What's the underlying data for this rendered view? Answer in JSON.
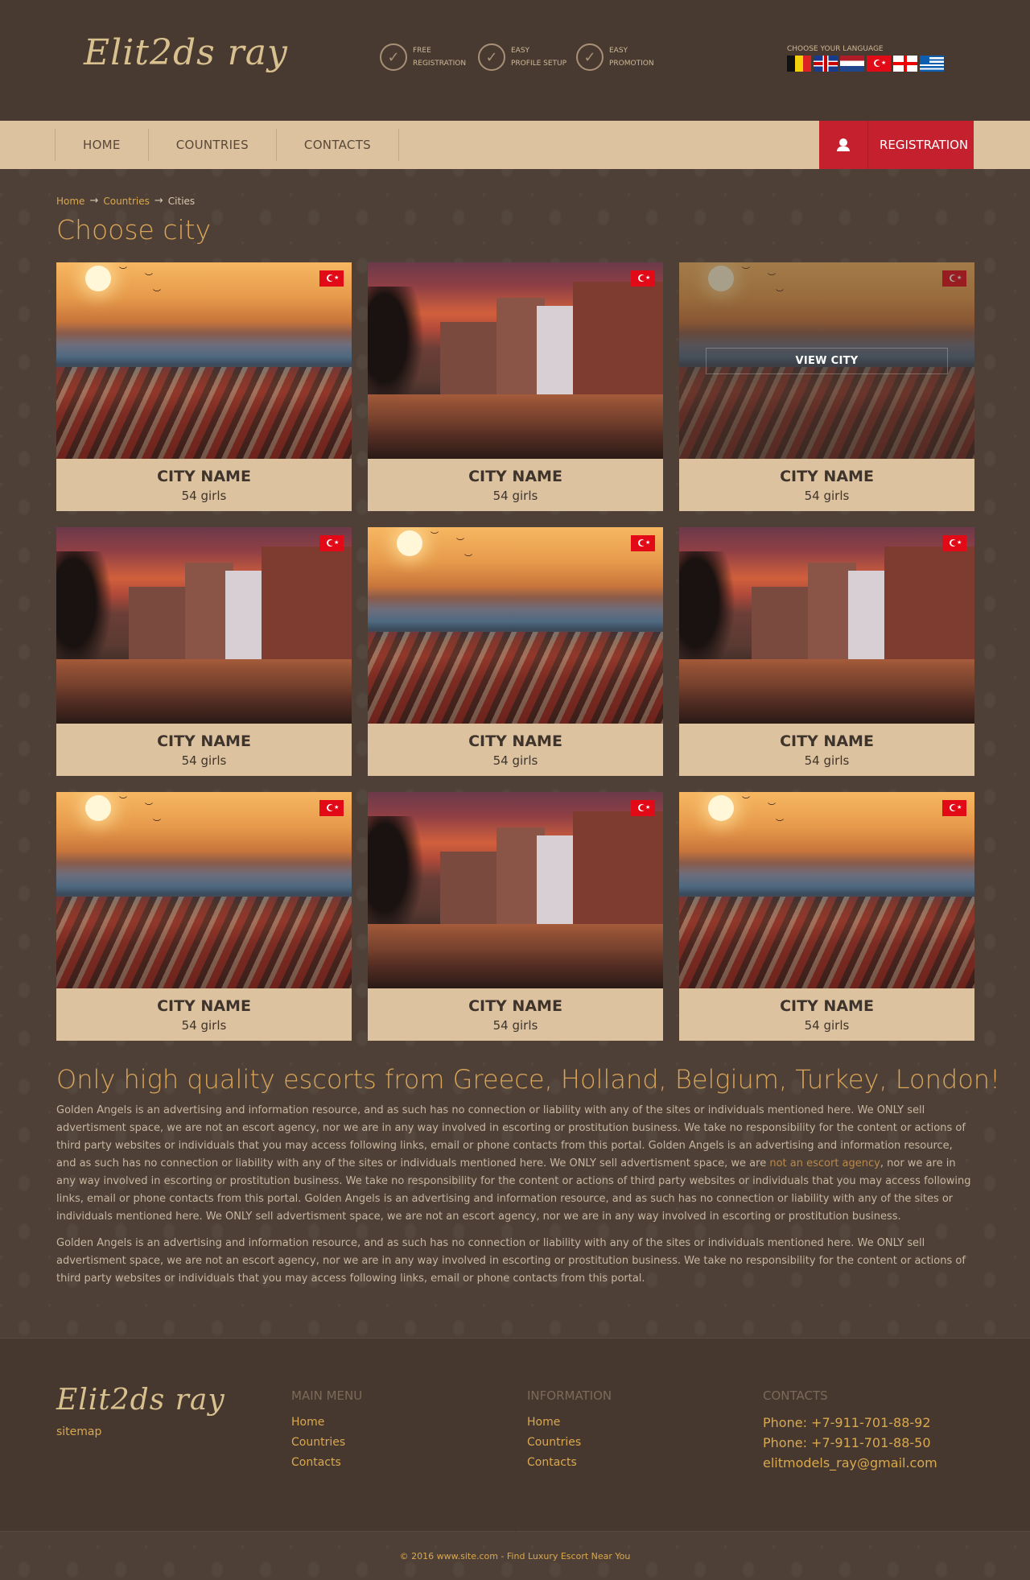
{
  "header": {
    "logo": "Elit2ds ray",
    "features": [
      "FREE\nREGISTRATION",
      "EASY\nPROFILE SETUP",
      "EASY\nPROMOTION"
    ],
    "language_label": "CHOOSE YOUR LANGUAGE",
    "flags": [
      "belgium-flag",
      "uk-flag",
      "netherlands-flag",
      "turkey-flag",
      "georgia-flag",
      "greece-flag"
    ]
  },
  "nav": {
    "items": [
      "HOME",
      "COUNTRIES",
      "CONTACTS"
    ],
    "registration": "REGISTRATION"
  },
  "breadcrumb": {
    "home": "Home",
    "countries": "Countries",
    "current": "Cities",
    "sep": "→"
  },
  "page_title": "Choose city",
  "view_city": "VIEW CITY",
  "cities": [
    {
      "name": "CITY NAME",
      "count": "54 girls",
      "scene": "city"
    },
    {
      "name": "CITY NAME",
      "count": "54 girls",
      "scene": "canal"
    },
    {
      "name": "CITY NAME",
      "count": "54 girls",
      "scene": "city"
    },
    {
      "name": "CITY NAME",
      "count": "54 girls",
      "scene": "canal"
    },
    {
      "name": "CITY NAME",
      "count": "54 girls",
      "scene": "city"
    },
    {
      "name": "CITY NAME",
      "count": "54 girls",
      "scene": "canal"
    },
    {
      "name": "CITY NAME",
      "count": "54 girls",
      "scene": "city"
    },
    {
      "name": "CITY NAME",
      "count": "54 girls",
      "scene": "canal"
    },
    {
      "name": "CITY NAME",
      "count": "54 girls",
      "scene": "city"
    }
  ],
  "seo": {
    "title": "Only high quality escorts from Greece, Holland, Belgium, Turkey, London!",
    "p1_before": "Golden Angels is an advertising and information resource, and as such has no connection or liability with any of the sites or individuals mentioned here. We ONLY sell advertisment space, we are not an escort agency, nor we are in any way involved in escorting or prostitution business. We take no responsibility for the content or actions of third party websites or individuals that you may access following links, email or phone contacts from this portal. Golden Angels is an advertising and information resource, and as such has no connection or liability with any of the sites or individuals mentioned here. We ONLY sell advertisment space, we are ",
    "p1_link": "not an escort agency",
    "p1_after": ", nor we are in any way involved in escorting or prostitution business. We take no responsibility for the content or actions of third party websites or individuals that you may access following links, email or phone contacts from this portal. Golden Angels is an advertising and information resource, and as such has no connection or liability with any of the sites or individuals mentioned here. We ONLY sell advertisment space, we are not an escort agency, nor we are in any way involved in escorting or prostitution business.",
    "p2": "Golden Angels is an advertising and information resource, and as such has no connection or liability with any of the sites or individuals mentioned here. We ONLY sell advertisment space, we are not an escort agency, nor we are in any way involved in escorting or prostitution business. We take no responsibility for the content or actions of third party websites or individuals that you may access following links, email or phone contacts from this portal."
  },
  "footer": {
    "logo": "Elit2ds ray",
    "sitemap": "sitemap",
    "main_menu": {
      "title": "MAIN MENU",
      "links": [
        "Home",
        "Countries",
        "Contacts"
      ]
    },
    "information": {
      "title": "INFORMATION",
      "links": [
        "Home",
        "Countries",
        "Contacts"
      ]
    },
    "contacts": {
      "title": "CONTACTS",
      "lines": [
        "Phone: +7-911-701-88-92",
        "Phone: +7-911-701-88-50",
        "elitmodels_ray@gmail.com"
      ]
    },
    "copyright": "© 2016 www.site.com - Find Luxury Escort Near You"
  },
  "colors": {
    "accent": "#d9a55a",
    "registration": "#c5202e",
    "nav_bg": "#dcc29f",
    "background": "#4e4036"
  }
}
